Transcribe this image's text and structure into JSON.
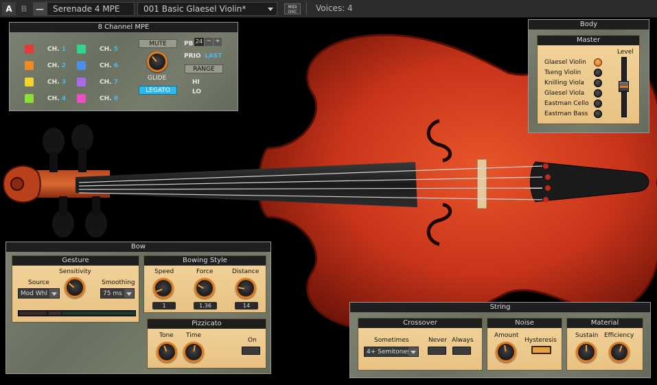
{
  "topbar": {
    "btn_a": "A",
    "btn_b": "B",
    "btn_minus": "—",
    "instrument": "Serenade 4 MPE",
    "preset": "001   Basic Glaesel Violin*",
    "midi_osc": [
      "MIDI",
      "OSC"
    ],
    "voices": "Voices: 4"
  },
  "mpe": {
    "title": "8 Channel MPE",
    "channels": [
      {
        "label": "CH.",
        "num": "1",
        "color": "#e8393a"
      },
      {
        "label": "CH.",
        "num": "2",
        "color": "#f08a24"
      },
      {
        "label": "CH.",
        "num": "3",
        "color": "#f3d42a"
      },
      {
        "label": "CH.",
        "num": "4",
        "color": "#8ce034"
      },
      {
        "label": "CH.",
        "num": "5",
        "color": "#2fd68a"
      },
      {
        "label": "CH.",
        "num": "6",
        "color": "#4a8fe8"
      },
      {
        "label": "CH.",
        "num": "7",
        "color": "#a96ae8"
      },
      {
        "label": "CH.",
        "num": "8",
        "color": "#ea4fc8"
      }
    ],
    "mute": "MUTE",
    "glide": "GLIDE",
    "legato": "LEGATO",
    "pb_label": "PB",
    "pb_value": "24",
    "pb_minus": "−",
    "pb_plus": "+",
    "prio_label": "PRIO",
    "prio_value": "LAST",
    "range": "RANGE",
    "hi": "HI",
    "lo": "LO"
  },
  "body": {
    "title": "Body",
    "master": "Master",
    "level": "Level",
    "instruments": [
      "Glaesel Violin",
      "Tseng Violin",
      "Knilling Viola",
      "Glaesel Viola",
      "Eastman Cello",
      "Eastman Bass"
    ],
    "selected": 0
  },
  "bow": {
    "title": "Bow",
    "gesture": {
      "title": "Gesture",
      "sensitivity": "Sensitivity",
      "source": "Source",
      "source_value": "Mod Whl",
      "smoothing": "Smoothing",
      "smoothing_value": "75 ms"
    },
    "style": {
      "title": "Bowing Style",
      "speed": "Speed",
      "speed_value": "1",
      "force": "Force",
      "force_value": "1.36",
      "distance": "Distance",
      "distance_value": "14"
    },
    "pizz": {
      "title": "Pizzicato",
      "tone": "Tone",
      "time": "Time",
      "on": "On"
    }
  },
  "string": {
    "title": "String",
    "crossover": {
      "title": "Crossover",
      "sometimes": "Sometimes",
      "never": "Never",
      "always": "Always",
      "semitones": "4+ Semitones"
    },
    "noise": {
      "title": "Noise",
      "amount": "Amount",
      "hysteresis": "Hysteresis"
    },
    "material": {
      "title": "Material",
      "sustain": "Sustain",
      "efficiency": "Efficiency"
    }
  }
}
